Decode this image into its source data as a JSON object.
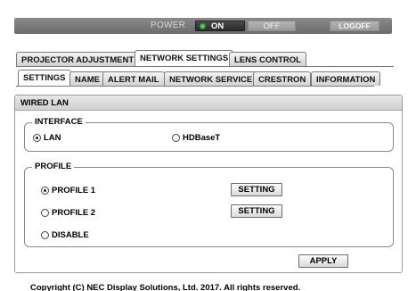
{
  "power": {
    "label": "POWER",
    "on_label": "ON",
    "off_label": "OFF",
    "logoff_label": "LOGOFF",
    "state": "on",
    "on_indicator_color": "#30e030"
  },
  "main_tabs": [
    {
      "label": "PROJECTOR ADJUSTMENT",
      "active": false
    },
    {
      "label": "NETWORK SETTINGS",
      "active": true
    },
    {
      "label": "LENS CONTROL",
      "active": false
    }
  ],
  "sub_tabs": [
    {
      "label": "SETTINGS",
      "active": true
    },
    {
      "label": "NAME",
      "active": false
    },
    {
      "label": "ALERT MAIL",
      "active": false
    },
    {
      "label": "NETWORK SERVICE",
      "active": false
    },
    {
      "label": "CRESTRON",
      "active": false
    },
    {
      "label": "INFORMATION",
      "active": false
    }
  ],
  "panel": {
    "title": "WIRED LAN",
    "interface": {
      "legend": "INTERFACE",
      "options": [
        {
          "label": "LAN",
          "selected": true
        },
        {
          "label": "HDBaseT",
          "selected": false
        }
      ]
    },
    "profile": {
      "legend": "PROFILE",
      "options": [
        {
          "label": "PROFILE 1",
          "selected": true,
          "button": "SETTING"
        },
        {
          "label": "PROFILE 2",
          "selected": false,
          "button": "SETTING"
        },
        {
          "label": "DISABLE",
          "selected": false
        }
      ]
    },
    "apply_label": "APPLY"
  },
  "footer": {
    "copyright": "Copyright (C) NEC Display Solutions, Ltd. 2017. All rights reserved."
  }
}
